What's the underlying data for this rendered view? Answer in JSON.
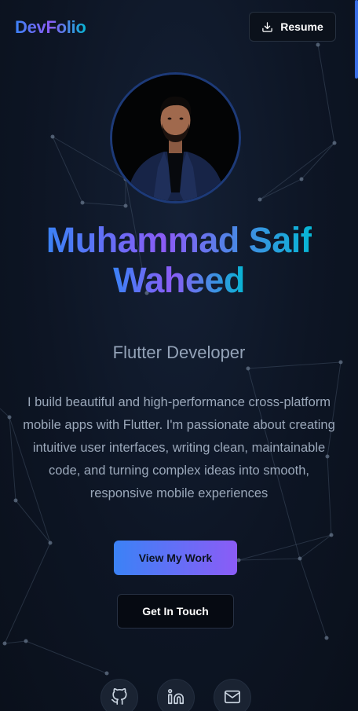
{
  "header": {
    "logo": "DevFolio",
    "resume_label": "Resume"
  },
  "hero": {
    "name_line1": "Muhammad Saif",
    "name_line2": "Waheed",
    "role": "Flutter Developer",
    "bio": "I build beautiful and high-performance cross-platform mobile apps with Flutter. I'm passionate about creating intuitive user interfaces, writing clean, maintainable code, and turning complex ideas into smooth, responsive mobile experiences",
    "primary_button": "View My Work",
    "secondary_button": "Get In Touch"
  },
  "social": [
    {
      "icon": "github-icon"
    },
    {
      "icon": "linkedin-icon"
    },
    {
      "icon": "mail-icon"
    }
  ],
  "colors": {
    "background": "#0c1320",
    "accent_blue": "#3b82f6",
    "accent_purple": "#8b5cf6",
    "accent_cyan": "#06b6d4",
    "muted_text": "#94a3b8"
  }
}
